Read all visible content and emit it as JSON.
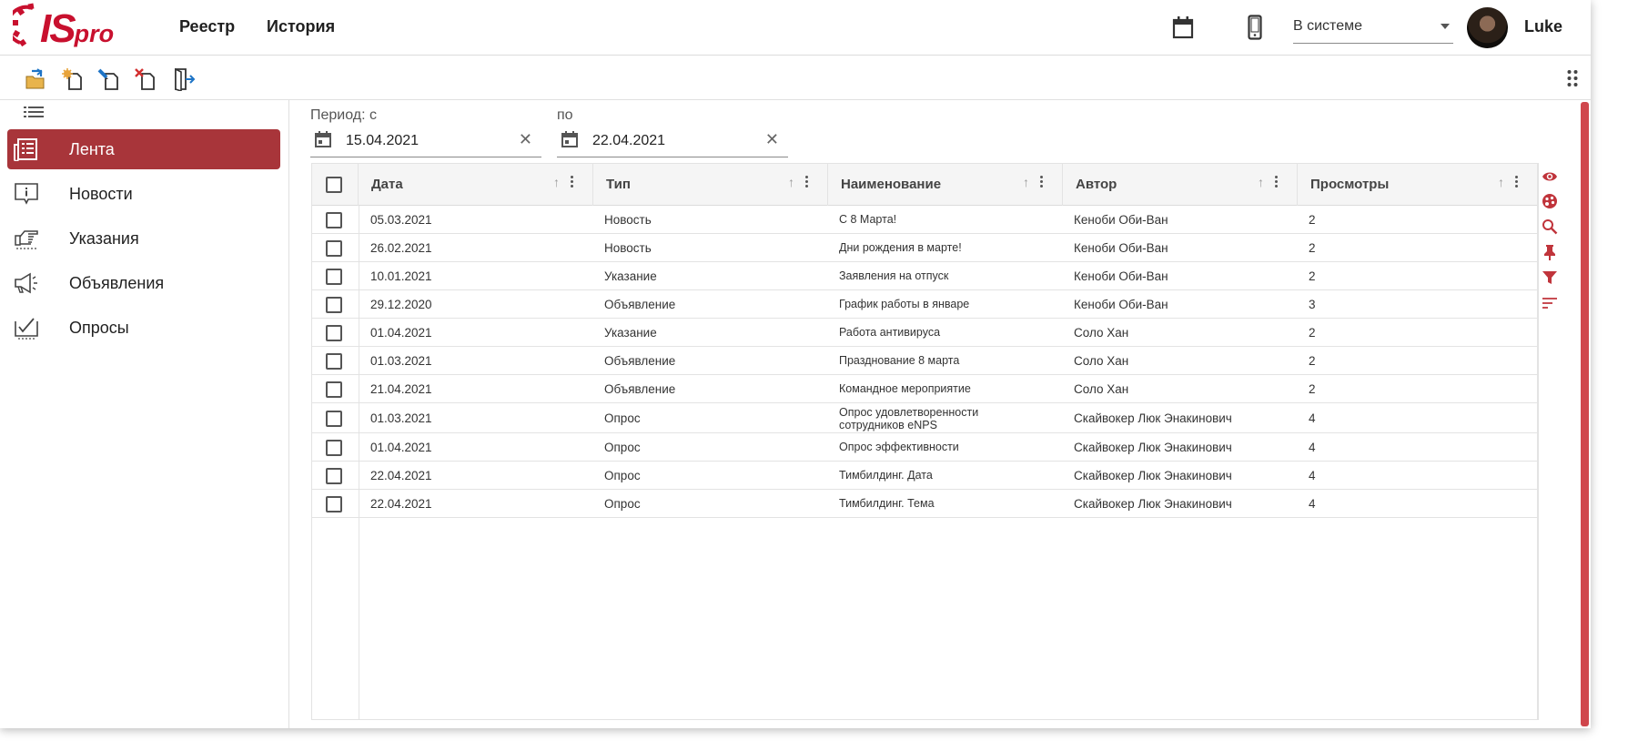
{
  "header": {
    "logo_text_is": "IS",
    "logo_text_pro": "pro",
    "nav": [
      "Реестр",
      "История"
    ],
    "status": "В системе",
    "username": "Luke"
  },
  "toolbar": {
    "buttons": [
      "open-folder-icon",
      "new-document-icon",
      "edit-document-icon",
      "delete-document-icon",
      "exit-icon"
    ]
  },
  "sidebar": {
    "items": [
      {
        "label": "Лента",
        "icon": "feed-icon",
        "active": true
      },
      {
        "label": "Новости",
        "icon": "news-icon",
        "active": false
      },
      {
        "label": "Указания",
        "icon": "pointing-hand-icon",
        "active": false
      },
      {
        "label": "Объявления",
        "icon": "megaphone-icon",
        "active": false
      },
      {
        "label": "Опросы",
        "icon": "poll-icon",
        "active": false
      }
    ]
  },
  "filter": {
    "period_from_label": "Период: с",
    "period_to_label": "по",
    "date_from": "15.04.2021",
    "date_to": "22.04.2021"
  },
  "table": {
    "columns": [
      "Дата",
      "Тип",
      "Наименование",
      "Автор",
      "Просмотры"
    ],
    "rows": [
      {
        "date": "05.03.2021",
        "type": "Новость",
        "name": "С 8 Марта!",
        "author": "Кеноби Оби-Ван",
        "views": "2"
      },
      {
        "date": "26.02.2021",
        "type": "Новость",
        "name": "Дни рождения в марте!",
        "author": "Кеноби Оби-Ван",
        "views": "2"
      },
      {
        "date": "10.01.2021",
        "type": "Указание",
        "name": "Заявления на отпуск",
        "author": "Кеноби Оби-Ван",
        "views": "2"
      },
      {
        "date": "29.12.2020",
        "type": "Объявление",
        "name": "График работы в январе",
        "author": "Кеноби Оби-Ван",
        "views": "3"
      },
      {
        "date": "01.04.2021",
        "type": "Указание",
        "name": "Работа антивируса",
        "author": "Соло Хан",
        "views": "2"
      },
      {
        "date": "01.03.2021",
        "type": "Объявление",
        "name": "Празднование 8 марта",
        "author": "Соло Хан",
        "views": "2"
      },
      {
        "date": "21.04.2021",
        "type": "Объявление",
        "name": "Командное мероприятие",
        "author": "Соло Хан",
        "views": "2"
      },
      {
        "date": "01.03.2021",
        "type": "Опрос",
        "name": "Опрос удовлетворенности сотрудников eNPS",
        "author": "Скайвокер Люк Энакинович",
        "views": "4"
      },
      {
        "date": "01.04.2021",
        "type": "Опрос",
        "name": "Опрос эффективности",
        "author": "Скайвокер Люк Энакинович",
        "views": "4"
      },
      {
        "date": "22.04.2021",
        "type": "Опрос",
        "name": "Тимбилдинг. Дата",
        "author": "Скайвокер Люк Энакинович",
        "views": "4"
      },
      {
        "date": "22.04.2021",
        "type": "Опрос",
        "name": "Тимбилдинг. Тема",
        "author": "Скайвокер Люк Энакинович",
        "views": "4"
      }
    ]
  },
  "rail": {
    "icons": [
      "eye-icon",
      "palette-icon",
      "search-icon",
      "pin-icon",
      "filter-icon",
      "sort-lines-icon"
    ]
  },
  "colors": {
    "accent": "#a8353a",
    "brand": "#c8102e",
    "rail_icon": "#c0343b",
    "scrollbar": "#d0464c"
  }
}
